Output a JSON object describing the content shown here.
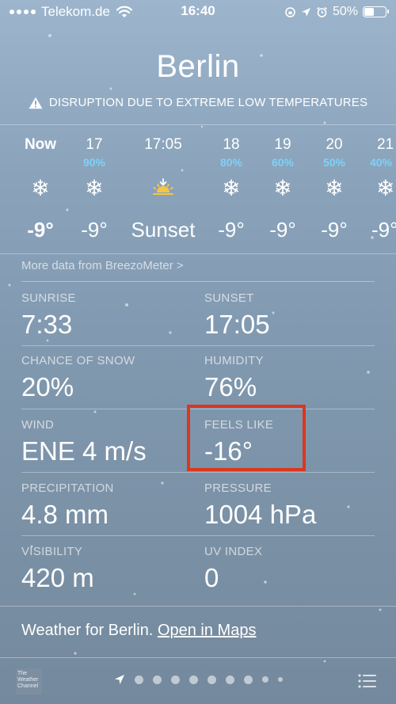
{
  "status_bar": {
    "carrier": "Telekom.de",
    "time": "16:40",
    "battery": "50%",
    "battery_level": 0.5
  },
  "location": {
    "city": "Berlin",
    "alert": "DISRUPTION DUE TO EXTREME LOW TEMPERATURES"
  },
  "hourly": [
    {
      "time": "Now",
      "precip": "",
      "icon": "snowflake-icon",
      "temp": "-9°"
    },
    {
      "time": "17",
      "precip": "90%",
      "icon": "snowflake-icon",
      "temp": "-9°"
    },
    {
      "time": "17:05",
      "precip": "",
      "icon": "sunset-icon",
      "temp": "Sunset"
    },
    {
      "time": "18",
      "precip": "80%",
      "icon": "snowflake-icon",
      "temp": "-9°"
    },
    {
      "time": "19",
      "precip": "60%",
      "icon": "snowflake-icon",
      "temp": "-9°"
    },
    {
      "time": "20",
      "precip": "50%",
      "icon": "snowflake-icon",
      "temp": "-9°"
    },
    {
      "time": "21",
      "precip": "40%",
      "icon": "snowflake-icon",
      "temp": "-9°"
    }
  ],
  "breezometer_link": "More data from BreezoMeter >",
  "details": [
    {
      "label": "SUNRISE",
      "value": "7:33"
    },
    {
      "label": "SUNSET",
      "value": "17:05"
    },
    {
      "label": "CHANCE OF SNOW",
      "value": "20%"
    },
    {
      "label": "HUMIDITY",
      "value": "76%"
    },
    {
      "label": "WIND",
      "value": "ENE 4 m/s"
    },
    {
      "label": "FEELS LIKE",
      "value": "-16°"
    },
    {
      "label": "PRECIPITATION",
      "value": "4.8 mm"
    },
    {
      "label": "PRESSURE",
      "value": "1004 hPa"
    },
    {
      "label": "VISIBILITY",
      "value": "420 m"
    },
    {
      "label": "UV INDEX",
      "value": "0"
    }
  ],
  "footer": {
    "text": "Weather for Berlin.",
    "link": "Open in Maps"
  },
  "bottom_bar": {
    "logo_text": "The Weather Channel"
  },
  "colors": {
    "precip_blue": "#7fd1f7",
    "highlight_red": "#d9381e"
  }
}
